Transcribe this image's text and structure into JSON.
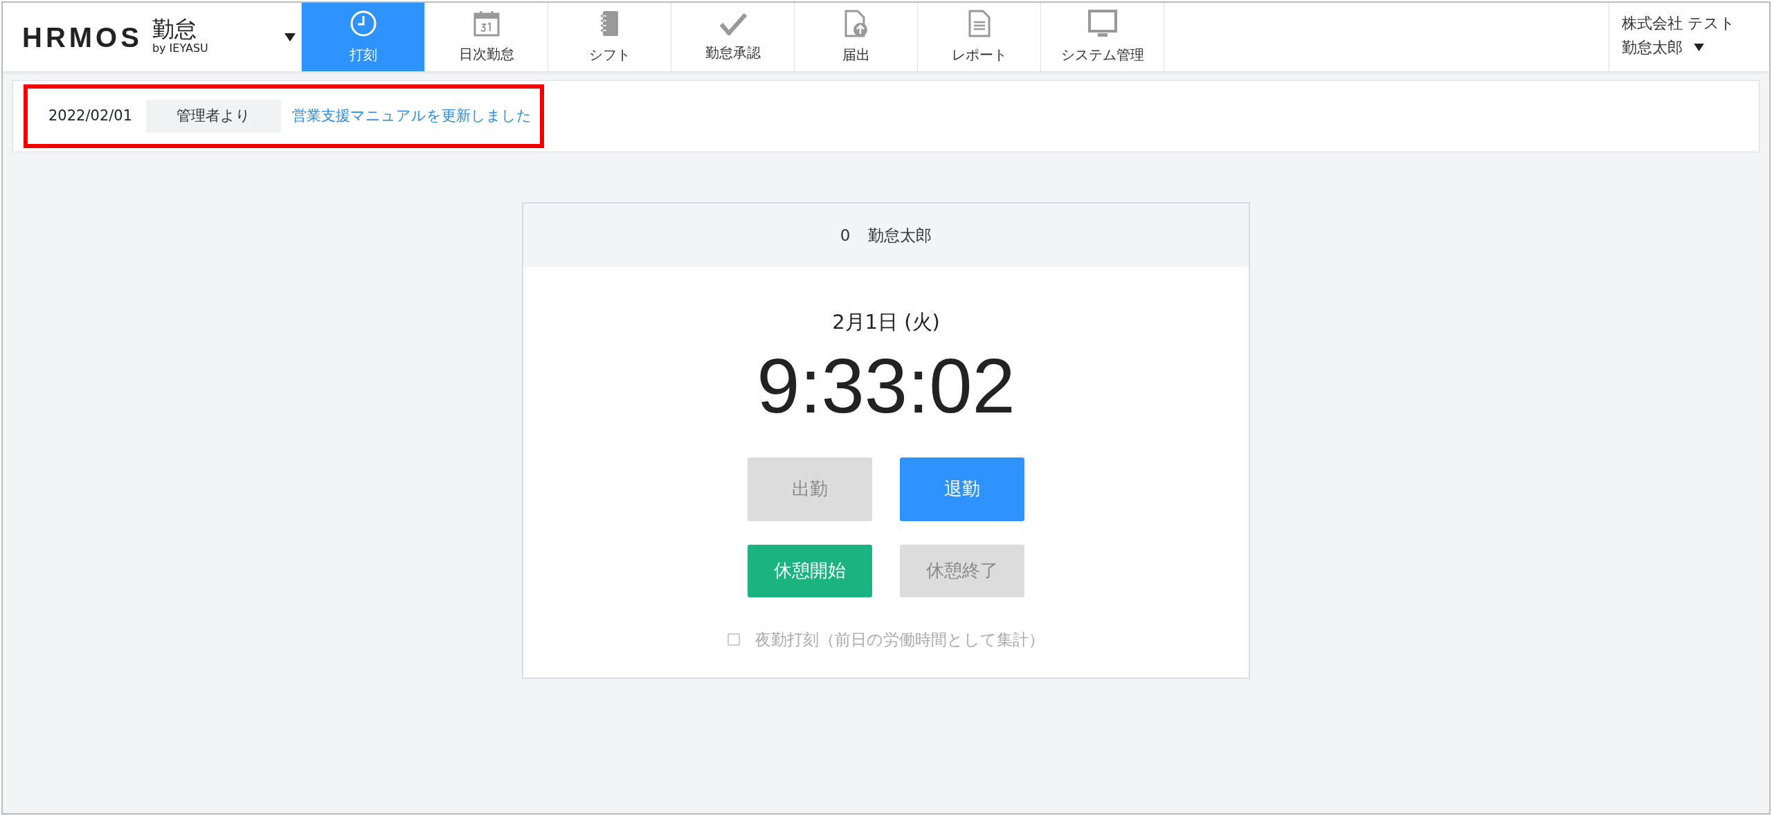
{
  "header": {
    "logo": "HRMOS",
    "logo_product": "勤怠",
    "logo_sub": "by IEYASU",
    "nav": [
      {
        "label": "打刻",
        "selected": true
      },
      {
        "label": "日次勤怠",
        "selected": false
      },
      {
        "label": "シフト",
        "selected": false
      },
      {
        "label": "勤怠承認",
        "selected": false
      },
      {
        "label": "届出",
        "selected": false
      },
      {
        "label": "レポート",
        "selected": false
      },
      {
        "label": "システム管理",
        "selected": false
      }
    ],
    "company": "株式会社 テスト",
    "user": "勤怠太郎"
  },
  "notice": {
    "date": "2022/02/01",
    "sender": "管理者より",
    "link": "営業支援マニュアルを更新しました",
    "highlighted": true
  },
  "clock_card": {
    "employee_number": "0",
    "employee_name": "勤怠太郎",
    "date": "2月1日 (火)",
    "time": "9:33:02",
    "buttons": [
      {
        "label": "出勤",
        "kind": "primary",
        "disabled": true
      },
      {
        "label": "退勤",
        "kind": "primary",
        "disabled": false
      },
      {
        "label": "休憩開始",
        "kind": "success",
        "disabled": false
      },
      {
        "label": "休憩終了",
        "kind": "success",
        "disabled": true
      }
    ],
    "night_shift": {
      "label": "夜勤打刻（前日の労働時間として集計）",
      "checked": false,
      "disabled": true
    }
  }
}
